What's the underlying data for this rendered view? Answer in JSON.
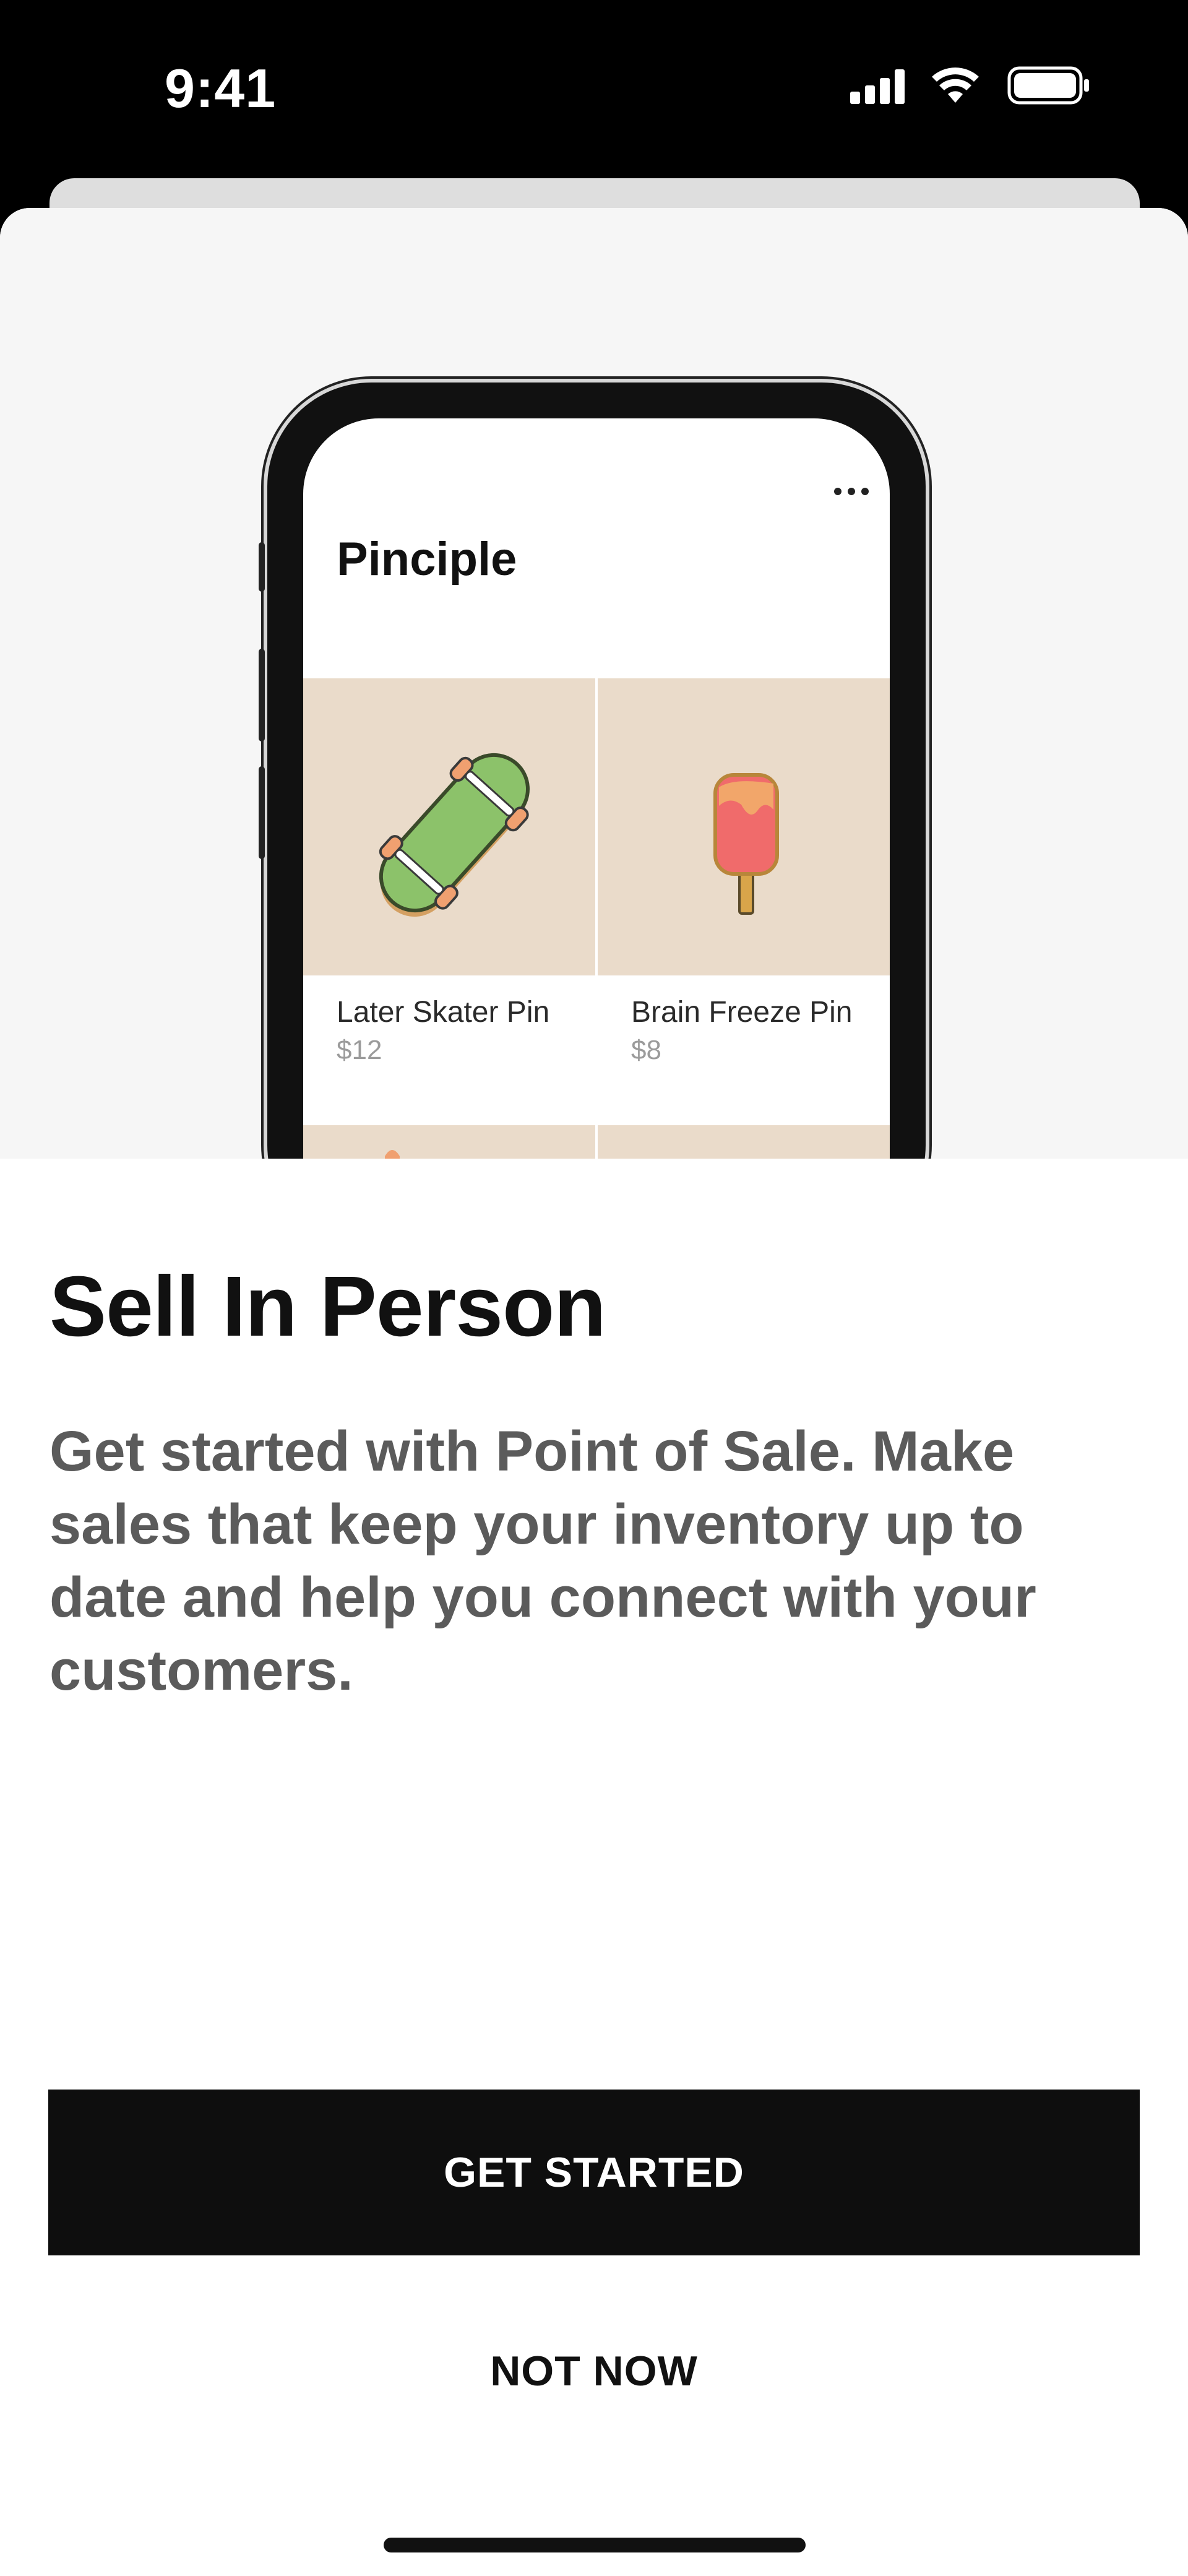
{
  "status_bar": {
    "time": "9:41",
    "icons": [
      "cellular-signal-icon",
      "wifi-icon",
      "battery-icon"
    ]
  },
  "preview": {
    "store_name": "Pinciple",
    "menu_icon": "more-horizontal-icon",
    "products": [
      {
        "name": "Later Skater Pin",
        "price": "$12",
        "image_icon": "skateboard-pin-icon"
      },
      {
        "name": "Brain Freeze Pin",
        "price": "$8",
        "image_icon": "popsicle-pin-icon"
      }
    ]
  },
  "content": {
    "title": "Sell In Person",
    "description": "Get started with Point of Sale. Make sales that keep your inventory up to date and help you connect with your customers."
  },
  "actions": {
    "primary_label": "GET STARTED",
    "secondary_label": "NOT NOW"
  },
  "colors": {
    "primary_button": "#0e0e0e",
    "product_background": "#eadbca",
    "hero_background": "#f6f6f6"
  }
}
